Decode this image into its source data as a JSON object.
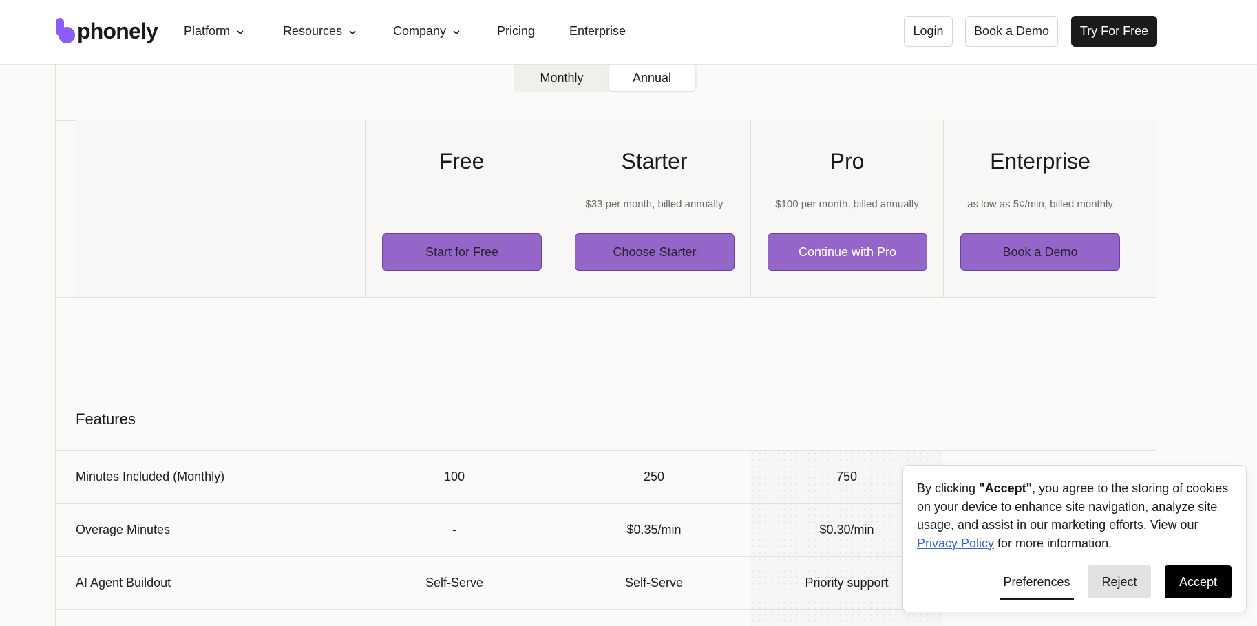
{
  "header": {
    "brand": "phonely",
    "nav": [
      {
        "label": "Platform",
        "dropdown": true
      },
      {
        "label": "Resources",
        "dropdown": true
      },
      {
        "label": "Company",
        "dropdown": true
      },
      {
        "label": "Pricing",
        "dropdown": false
      },
      {
        "label": "Enterprise",
        "dropdown": false
      }
    ],
    "login_label": "Login",
    "demo_label": "Book a Demo",
    "try_label": "Try For Free"
  },
  "billing_toggle": {
    "monthly_label": "Monthly",
    "annual_label": "Annual",
    "selected": "Annual"
  },
  "plans": [
    {
      "name": "Free",
      "price_note": "",
      "cta": "Start for Free"
    },
    {
      "name": "Starter",
      "price_note": "$33 per month, billed annually",
      "cta": "Choose Starter"
    },
    {
      "name": "Pro",
      "price_note": "$100 per month, billed annually",
      "cta": "Continue with Pro"
    },
    {
      "name": "Enterprise",
      "price_note": "as low as 5¢/min, billed monthly",
      "cta": "Book a Demo"
    }
  ],
  "features": {
    "title": "Features",
    "rows": [
      {
        "label": "Minutes Included (Monthly)",
        "values": [
          "100",
          "250",
          "750"
        ]
      },
      {
        "label": "Overage Minutes",
        "values": [
          "-",
          "$0.35/min",
          "$0.30/min"
        ]
      },
      {
        "label": "AI Agent Buildout",
        "values": [
          "Self-Serve",
          "Self-Serve",
          "Priority support"
        ]
      }
    ]
  },
  "cookie_banner": {
    "text_before": "By clicking ",
    "accept_quoted": "\"Accept\"",
    "text_middle": ", you agree to the storing of cookies on your device to enhance site navigation, analyze site usage, and assist in our marketing efforts. View our ",
    "privacy_link": "Privacy Policy",
    "text_after": " for more information.",
    "preferences_label": "Preferences",
    "reject_label": "Reject",
    "accept_label": "Accept"
  },
  "colors": {
    "accent_purple": "#9566c9",
    "background": "#fbfaf8",
    "dark_button": "#1c1a1b"
  },
  "icons": [
    "phonely-logo-icon",
    "chevron-down-icon"
  ]
}
